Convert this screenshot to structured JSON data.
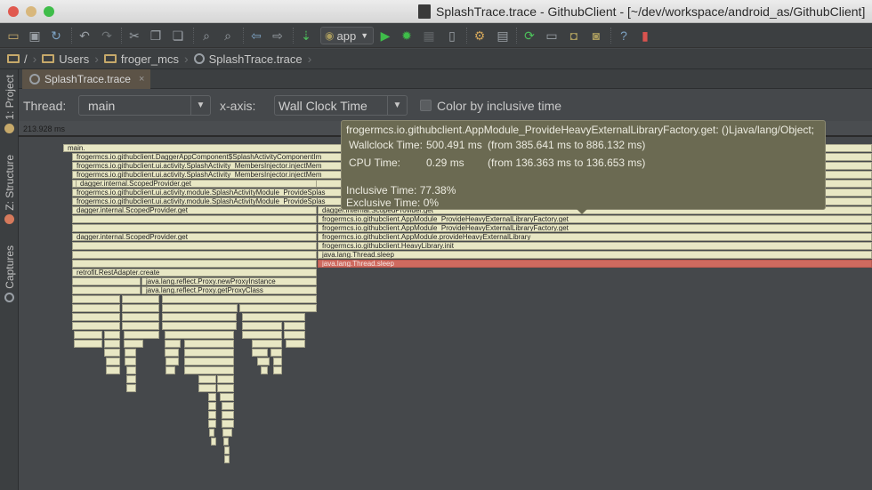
{
  "window": {
    "title": "SplashTrace.trace - GithubClient - [~/dev/workspace/android_as/GithubClient]"
  },
  "toolbar": {
    "icons": [
      "open-folder-icon",
      "save-icon",
      "sync-icon",
      "undo-icon",
      "redo-icon",
      "cut-icon",
      "copy-icon",
      "paste-icon",
      "find-icon",
      "replace-icon",
      "back-icon",
      "forward-icon",
      "make-project-icon",
      "run-config-android-icon",
      "run-icon",
      "debug-icon",
      "coverage-icon",
      "attach-debugger-icon",
      "project-structure-icon",
      "sdk-manager-icon",
      "gradle-sync-icon",
      "avd-manager-icon",
      "sdk-android-icon",
      "android-device-monitor-icon",
      "help-icon",
      "android-monitor-icon"
    ],
    "run_config_label": "app"
  },
  "breadcrumb": {
    "items": [
      "/",
      "Users",
      "froger_mcs",
      "SplashTrace.trace"
    ]
  },
  "sidebar": {
    "tabs": [
      {
        "label": "1: Project"
      },
      {
        "label": "Z: Structure"
      },
      {
        "label": "Captures"
      }
    ]
  },
  "editor": {
    "tab_label": "SplashTrace.trace",
    "close_glyph": "×"
  },
  "controls": {
    "thread_label": "Thread:",
    "thread_value": "main",
    "xaxis_label": "x-axis:",
    "xaxis_value": "Wall Clock Time",
    "color_by_label": "Color by inclusive time",
    "color_by_checked": false
  },
  "ruler": {
    "time_label": "213.928 ms"
  },
  "colors": {
    "frame_fill": "#e8e7c4",
    "frame_hot": "#cf6a5f",
    "tooltip_bg": "#6b6a52"
  },
  "flame": {
    "labels": [
      "main.",
      "frogermcs.io.githubclient.DaggerAppComponent$SplashActivityComponentIm",
      "frogermcs.io.githubclient.ui.activity.SplashActivity_MembersInjector.injectMem",
      "frogermcs.io.githubclient.ui.activity.SplashActivity_MembersInjector.injectMem",
      "dagger.internal.ScopedProvider.get",
      "frogermcs.io.githubclient.ui.activity.module.SplashActivityModule_ProvideSplas",
      "frogermcs.io.githubclient.ui.activity.module.SplashActivityModule_ProvideSplas",
      "dagger.internal.ScopedProvider.get",
      "dagger.internal.ScopedProvider.get",
      "frogermcs.io.githubclient.AppModule_ProvideHeavyExternalLibraryFactory.get",
      "frogermcs.io.githubclient.AppModule_ProvideHeavyExternalLibraryFactory.get",
      "dagger.internal.ScopedProvider.get",
      "frogermcs.io.githubclient.AppModule.provideHeavyExternalLibrary",
      "frogermcs.io.githubclient.HeavyLibrary.init",
      "java.lang.Thread.sleep",
      "java.lang.Thread.sleep",
      "retrofit.RestAdapter.create",
      "java.lang.reflect.Proxy.newProxyInstance",
      "java.lang.reflect.Proxy.getProxyClass"
    ]
  },
  "tooltip": {
    "method": "frogermcs.io.githubclient.AppModule_ProvideHeavyExternalLibraryFactory.get: ()Ljava/lang/Object;",
    "wallclock_label": "Wallclock Time:",
    "wallclock_value": "500.491 ms",
    "wallclock_range": "(from 385.641 ms to 886.132 ms)",
    "cpu_label": "CPU Time:",
    "cpu_value": "0.29 ms",
    "cpu_range": "(from 136.363 ms to 136.653 ms)",
    "inclusive": "Inclusive Time: 77.38%",
    "exclusive": "Exclusive Time: 0%"
  }
}
